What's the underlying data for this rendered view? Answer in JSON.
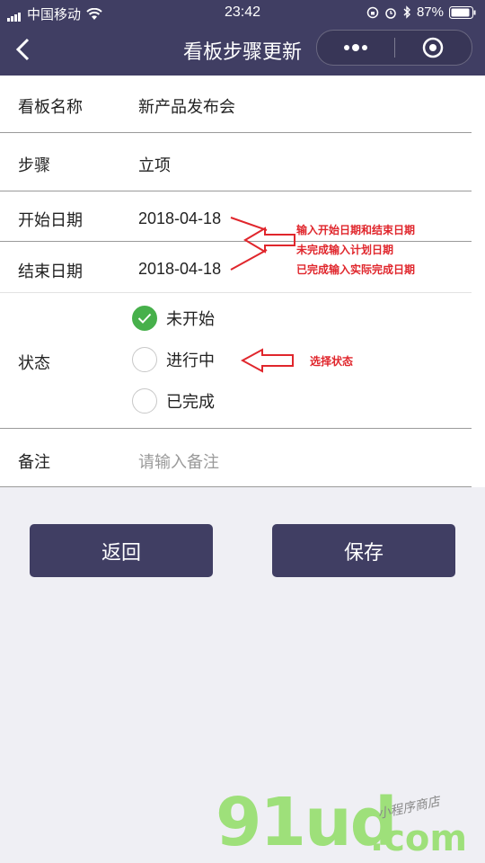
{
  "status_bar": {
    "carrier": "中国移动",
    "time": "23:42",
    "battery": "87%"
  },
  "nav": {
    "title": "看板步骤更新",
    "back_icon": "chevron-left-icon",
    "more_icon": "more-dots-icon",
    "close_icon": "target-circle-icon"
  },
  "form": {
    "board_name": {
      "label": "看板名称",
      "value": "新产品发布会"
    },
    "step": {
      "label": "步骤",
      "value": "立项"
    },
    "start_date": {
      "label": "开始日期",
      "value": "2018-04-18"
    },
    "end_date": {
      "label": "结束日期",
      "value": "2018-04-18"
    },
    "status": {
      "label": "状态",
      "options": [
        {
          "label": "未开始",
          "checked": true
        },
        {
          "label": "进行中",
          "checked": false
        },
        {
          "label": "已完成",
          "checked": false
        }
      ]
    },
    "remark": {
      "label": "备注",
      "placeholder": "请输入备注"
    }
  },
  "annotations": {
    "date_line1": "输入开始日期和结束日期",
    "date_line2": "未完成输入计划日期",
    "date_line3": "已完成输入实际完成日期",
    "status_note": "选择状态"
  },
  "buttons": {
    "back": "返回",
    "save": "保存"
  },
  "watermark": {
    "brand": "91ud",
    "domain": ".com",
    "tagline": "小程序商店"
  },
  "colors": {
    "header": "#403e63",
    "checked": "#47b04b",
    "annotation": "#e0262c",
    "watermark_green": "#9ee07a"
  }
}
